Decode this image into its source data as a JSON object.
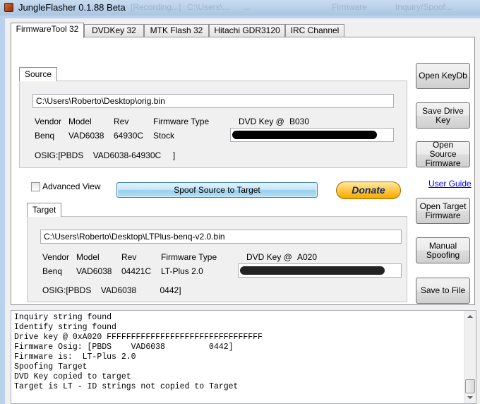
{
  "window": {
    "title": "JungleFlasher 0.1.88 Beta",
    "background_titles": [
      "[Recording...]",
      "C:\\Users\\...",
      "...",
      "Firmware",
      "Inquiry/Spoof..."
    ]
  },
  "tabs": [
    {
      "label": "FirmwareTool 32",
      "active": true
    },
    {
      "label": "DVDKey 32",
      "active": false
    },
    {
      "label": "MTK Flash 32",
      "active": false
    },
    {
      "label": "Hitachi GDR3120",
      "active": false
    },
    {
      "label": "IRC Channel",
      "active": false
    }
  ],
  "source": {
    "group_label": "Source",
    "path": "C:\\Users\\Roberto\\Desktop\\orig.bin",
    "headers": {
      "vendor": "Vendor",
      "model": "Model",
      "rev": "Rev",
      "fw_type": "Firmware Type",
      "dvd_key": "DVD Key @"
    },
    "key_offset": "B030",
    "vendor": "Benq",
    "model": "VAD6038",
    "rev": "64930C",
    "fw_type": "Stock",
    "dvd_key_redacted": true,
    "osig": "OSIG:[PBDS    VAD6038-64930C     ]"
  },
  "target": {
    "group_label": "Target",
    "path": "C:\\Users\\Roberto\\Desktop\\LTPlus-benq-v2.0.bin",
    "headers": {
      "vendor": "Vendor",
      "model": "Model",
      "rev": "Rev",
      "fw_type": "Firmware Type",
      "dvd_key": "DVD Key @"
    },
    "key_offset": "A020",
    "vendor": "Benq",
    "model": "VAD6038",
    "rev": "04421C",
    "fw_type": "LT-Plus 2.0",
    "dvd_key_redacted": true,
    "osig": "OSIG:[PBDS    VAD6038          0442]"
  },
  "controls": {
    "advanced_view": "Advanced View",
    "advanced_view_checked": false,
    "spoof_button": "Spoof Source to Target",
    "donate": "Donate",
    "user_guide": "User Guide"
  },
  "side_buttons": {
    "open_keydb": "Open  KeyDb",
    "save_drive_key": "Save Drive Key",
    "open_source_fw": "Open Source Firmware",
    "open_target_fw": "Open Target Firmware",
    "manual_spoofing": "Manual Spoofing",
    "save_to_file": "Save to File"
  },
  "log": [
    "Inquiry string found",
    "Identify string found",
    "Drive key @ 0xA020 FFFFFFFFFFFFFFFFFFFFFFFFFFFFFFFF",
    "Firmware Osig: [PBDS    VAD6038         0442]",
    "Firmware is:  LT-Plus 2.0",
    "Spoofing Target",
    "DVD Key copied to target",
    "Target is LT - ID strings not copied to Target"
  ],
  "colors": {
    "accent": "#3c7fb1",
    "donate": "#ffc43a",
    "link": "#0000ee",
    "titlebar": "#a9c6e3"
  }
}
